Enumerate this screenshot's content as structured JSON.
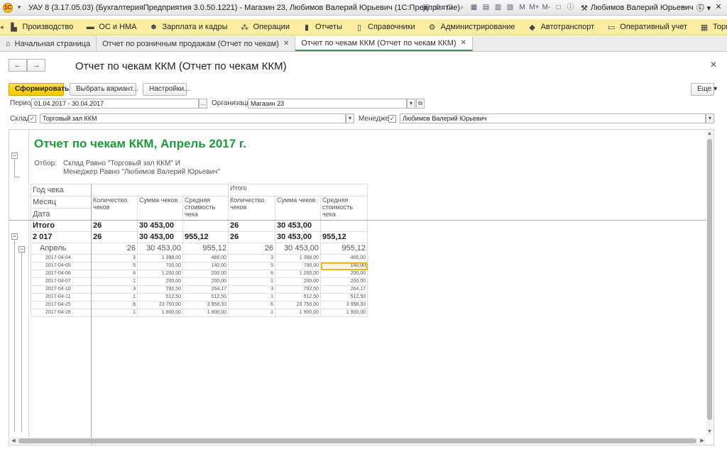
{
  "window": {
    "title": "УАУ 8 (3.17.05.03) (БухгалтерияПредприятия 3.0.50.1221) - Магазин 23, Любимов Валерий Юрьевич  (1С:Предприятие)",
    "user": "Любимов Валерий Юрьевич",
    "toolbar_icons": [
      "save-icon",
      "print-icon",
      "preview-icon",
      "search-icon",
      "calendar-icon",
      "calculator-icon",
      "calendar-icon",
      "table-icon",
      "m-icon",
      "m-plus-icon",
      "m-minus-icon",
      "screen-icon",
      "info-icon"
    ],
    "toolbar_texts": {
      "m": "M",
      "m_plus": "M+",
      "m_minus": "M-"
    }
  },
  "sections": [
    {
      "label": "Производство",
      "icon": "factory-icon"
    },
    {
      "label": "ОС и НМА",
      "icon": "truck-icon"
    },
    {
      "label": "Зарплата и кадры",
      "icon": "people-icon"
    },
    {
      "label": "Операции",
      "icon": "operations-icon"
    },
    {
      "label": "Отчеты",
      "icon": "chart-icon"
    },
    {
      "label": "Справочники",
      "icon": "book-icon"
    },
    {
      "label": "Администрирование",
      "icon": "gear-icon"
    },
    {
      "label": "Автотранспорт",
      "icon": "car-icon"
    },
    {
      "label": "Оперативный учет",
      "icon": "monitor-icon"
    },
    {
      "label": "Торговля",
      "icon": "calc-icon"
    }
  ],
  "tabs": [
    {
      "label": "Начальная страница",
      "active": false
    },
    {
      "label": "Отчет по розничным продажам (Отчет по чекам)",
      "active": false
    },
    {
      "label": "Отчет по чекам ККМ (Отчет по чекам ККМ)",
      "active": true
    }
  ],
  "form": {
    "title": "Отчет по чекам ККМ (Отчет по чекам ККМ)",
    "buttons": {
      "generate": "Сформировать",
      "variant": "Выбрать вариант...",
      "settings": "Настройки...",
      "more": "Еще"
    },
    "period_label": "Период:",
    "period_value": "01.04.2017 - 30.04.2017",
    "org_label": "Организация:",
    "org_value": "Магазин 23",
    "warehouse_label": "Склад:",
    "warehouse_value": "Торговый зал ККМ",
    "manager_label": "Менеджер:",
    "manager_value": "Любимов Валерий Юрьевич",
    "ellipsis": "...",
    "more_arrow": "▾"
  },
  "report": {
    "title": "Отчет по чекам ККМ, Апрель 2017 г.",
    "filter_label": "Отбор:",
    "filter_lines": [
      "Склад Равно \"Торговый зал ККМ\" И",
      "Менеджер Равно \"Любимов Валерий Юрьевич\""
    ],
    "row_headers": [
      "Год чека",
      "Месяц",
      "Дата"
    ],
    "group_header": "Итого",
    "columns": [
      "Количество чеков",
      "Сумма чеков",
      "Средняя стоимость чека"
    ],
    "total_row": {
      "label": "Итого",
      "count": "26",
      "sum": "30 453,00",
      "avg": "",
      "t_count": "26",
      "t_sum": "30 453,00",
      "t_avg": ""
    },
    "year_row": {
      "label": "2 017",
      "count": "26",
      "sum": "30 453,00",
      "avg": "955,12",
      "t_count": "26",
      "t_sum": "30 453,00",
      "t_avg": "955,12"
    },
    "month_row": {
      "label": "Апрель",
      "count": "26",
      "sum": "30 453,00",
      "avg": "955,12",
      "t_count": "26",
      "t_sum": "30 453,00",
      "t_avg": "955,12"
    },
    "rows": [
      {
        "date": "2017-04-04",
        "count": "3",
        "sum": "1 398,00",
        "avg": "466,00"
      },
      {
        "date": "2017-04-05",
        "count": "5",
        "sum": "700,00",
        "avg": "140,00"
      },
      {
        "date": "2017-04-06",
        "count": "6",
        "sum": "1 200,00",
        "avg": "200,00"
      },
      {
        "date": "2017-04-07",
        "count": "1",
        "sum": "200,00",
        "avg": "200,00"
      },
      {
        "date": "2017-04-10",
        "count": "3",
        "sum": "792,50",
        "avg": "264,17"
      },
      {
        "date": "2017-04-11",
        "count": "1",
        "sum": "512,50",
        "avg": "512,50"
      },
      {
        "date": "2017-04-25",
        "count": "6",
        "sum": "23 750,00",
        "avg": "3 958,33"
      },
      {
        "date": "2017-04-28",
        "count": "1",
        "sum": "1 900,00",
        "avg": "1 900,00"
      }
    ]
  }
}
